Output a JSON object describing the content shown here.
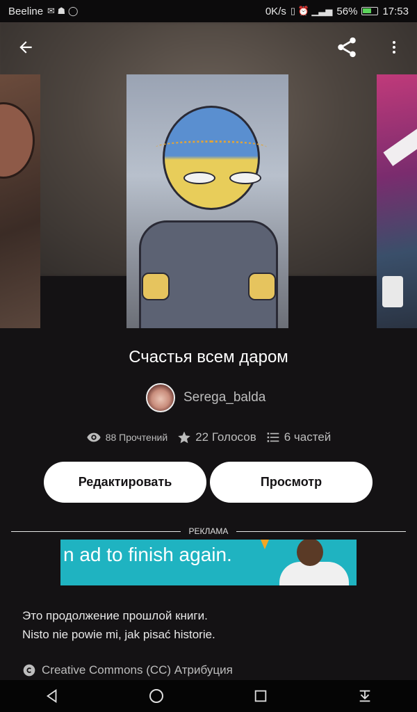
{
  "status_bar": {
    "carrier": "Beeline",
    "network_speed": "0K/s",
    "battery_percent": "56%",
    "time": "17:53"
  },
  "book": {
    "title": "Счастья всем даром",
    "author": "Serega_balda",
    "stats": {
      "reads": "88 Прочтений",
      "votes": "22 Голосов",
      "parts": "6 частей"
    },
    "description_lines": [
      "Это  продолжение прошлой книги.",
      "Nisto nie powie mi, jak pisać historie."
    ],
    "license": "Creative Commons (CC) Атрибуция"
  },
  "actions": {
    "edit_label": "Редактировать",
    "view_label": "Просмотр"
  },
  "ad": {
    "label": "РЕКЛАМА",
    "banner_text": "n ad to finish again."
  },
  "icons": {
    "back": "arrow-left-icon",
    "share": "share-icon",
    "more": "more-vertical-icon",
    "reads": "eye-icon",
    "votes": "star-icon",
    "parts": "list-icon",
    "license": "copyright-icon"
  },
  "colors": {
    "background": "#141214",
    "button_bg": "#ffffff",
    "ad_banner": "#1fb3c1",
    "secondary_text": "#bdbdbd"
  }
}
